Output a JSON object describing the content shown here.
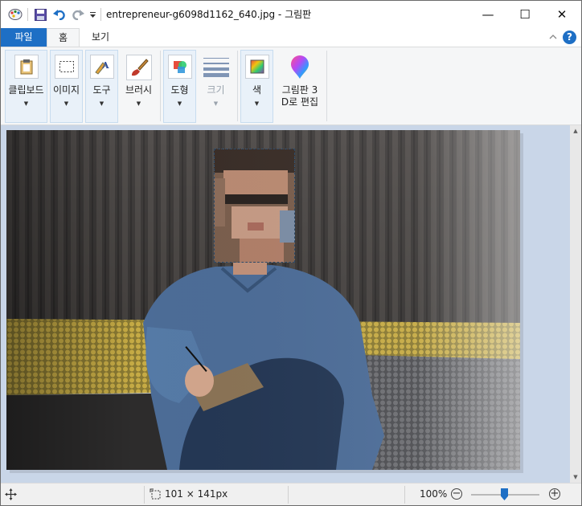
{
  "window": {
    "title": "entrepreneur-g6098d1162_640.jpg - 그림판",
    "controls": {
      "minimize": "—",
      "maximize": "☐",
      "close": "✕"
    }
  },
  "quick_access": {
    "app_icon": "paint-palette-icon",
    "save_icon": "save-disk-icon",
    "undo_icon": "undo-arrow-icon",
    "redo_icon": "redo-arrow-icon",
    "customize_icon": "customize-dropdown-icon"
  },
  "tabs": [
    {
      "label": "파일",
      "active": false
    },
    {
      "label": "홈",
      "active": true
    },
    {
      "label": "보기",
      "active": false
    }
  ],
  "ribbon": {
    "groups": [
      {
        "label": "클립보드",
        "icon": "clipboard-icon",
        "has_menu": true,
        "disabled": false
      },
      {
        "label": "이미지",
        "icon": "select-icon",
        "has_menu": true,
        "disabled": false
      },
      {
        "label": "도구",
        "icon": "tools-icon",
        "has_menu": true,
        "disabled": false
      },
      {
        "label": "브러시",
        "icon": "brush-icon",
        "has_menu": true,
        "disabled": false
      },
      {
        "label": "도형",
        "icon": "shapes-icon",
        "has_menu": true,
        "disabled": false
      },
      {
        "label": "크기",
        "icon": "line-size-icon",
        "has_menu": true,
        "disabled": true
      },
      {
        "label": "색",
        "icon": "color-palette-icon",
        "has_menu": true,
        "disabled": false
      },
      {
        "label_line1": "그림판 3",
        "label_line2": "D로 편집",
        "icon": "paint-3d-icon",
        "has_menu": false,
        "disabled": false
      }
    ]
  },
  "status": {
    "move_icon": "move-crosshair-icon",
    "selection_icon": "selection-size-icon",
    "selection_size": "101 × 141px",
    "zoom": "100%",
    "zoom_out": "−",
    "zoom_in": "+",
    "zoom_level": 0.5
  },
  "colors": {
    "accent": "#1e6fc5",
    "workspace": "#c9d6e8",
    "ribbon_bg": "#f5f6f7",
    "group_bg": "#e9f1f9"
  }
}
